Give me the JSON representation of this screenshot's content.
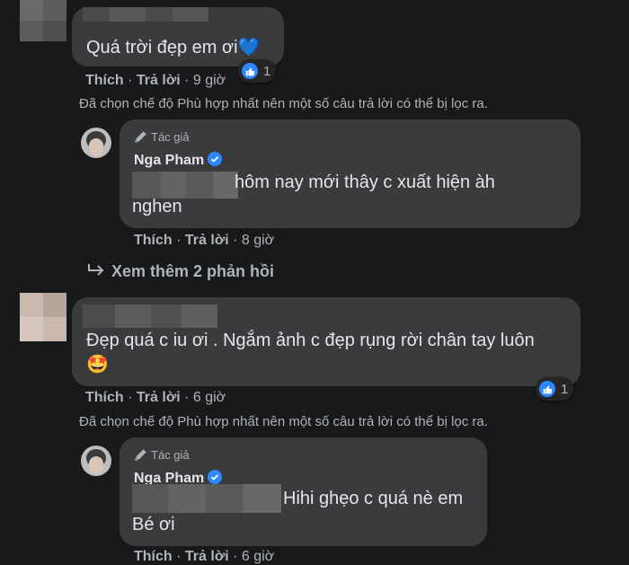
{
  "comments": [
    {
      "text": "Quá trời đẹp em ơi💙",
      "like_label": "Thích",
      "reply_label": "Trả lời",
      "time": "9 giờ",
      "reaction_count": "1",
      "filter_note": "Đã chọn chế độ Phù hợp nhất nên một số câu trả lời có thể bị lọc ra.",
      "reply": {
        "author_tag": "Tác giả",
        "author_name": "Nga Pham",
        "text_line1": "hôm nay mới thây c xuất hiện àh",
        "text_line2": "nghen",
        "like_label": "Thích",
        "reply_label": "Trả lời",
        "time": "8 giờ"
      },
      "view_more": "Xem thêm 2 phản hồi"
    },
    {
      "text_line1": "Đẹp quá c iu ơi . Ngắm ảnh c đẹp rụng rời chân tay luôn",
      "text_line2": "🤩",
      "like_label": "Thích",
      "reply_label": "Trả lời",
      "time": "6 giờ",
      "reaction_count": "1",
      "filter_note": "Đã chọn chế độ Phù hợp nhất nên một số câu trả lời có thể bị lọc ra.",
      "reply": {
        "author_tag": "Tác giả",
        "author_name": "Nga Pham",
        "text_line1": "Hihi ghẹo c quá nè em",
        "text_line2": "Bé ơi",
        "like_label": "Thích",
        "reply_label": "Trả lời",
        "time": "6 giờ"
      }
    }
  ],
  "colors": {
    "background": "#18191a",
    "bubble": "#3a3b3c",
    "accent": "#2d88ff",
    "secondary_text": "#b0b3b8"
  }
}
